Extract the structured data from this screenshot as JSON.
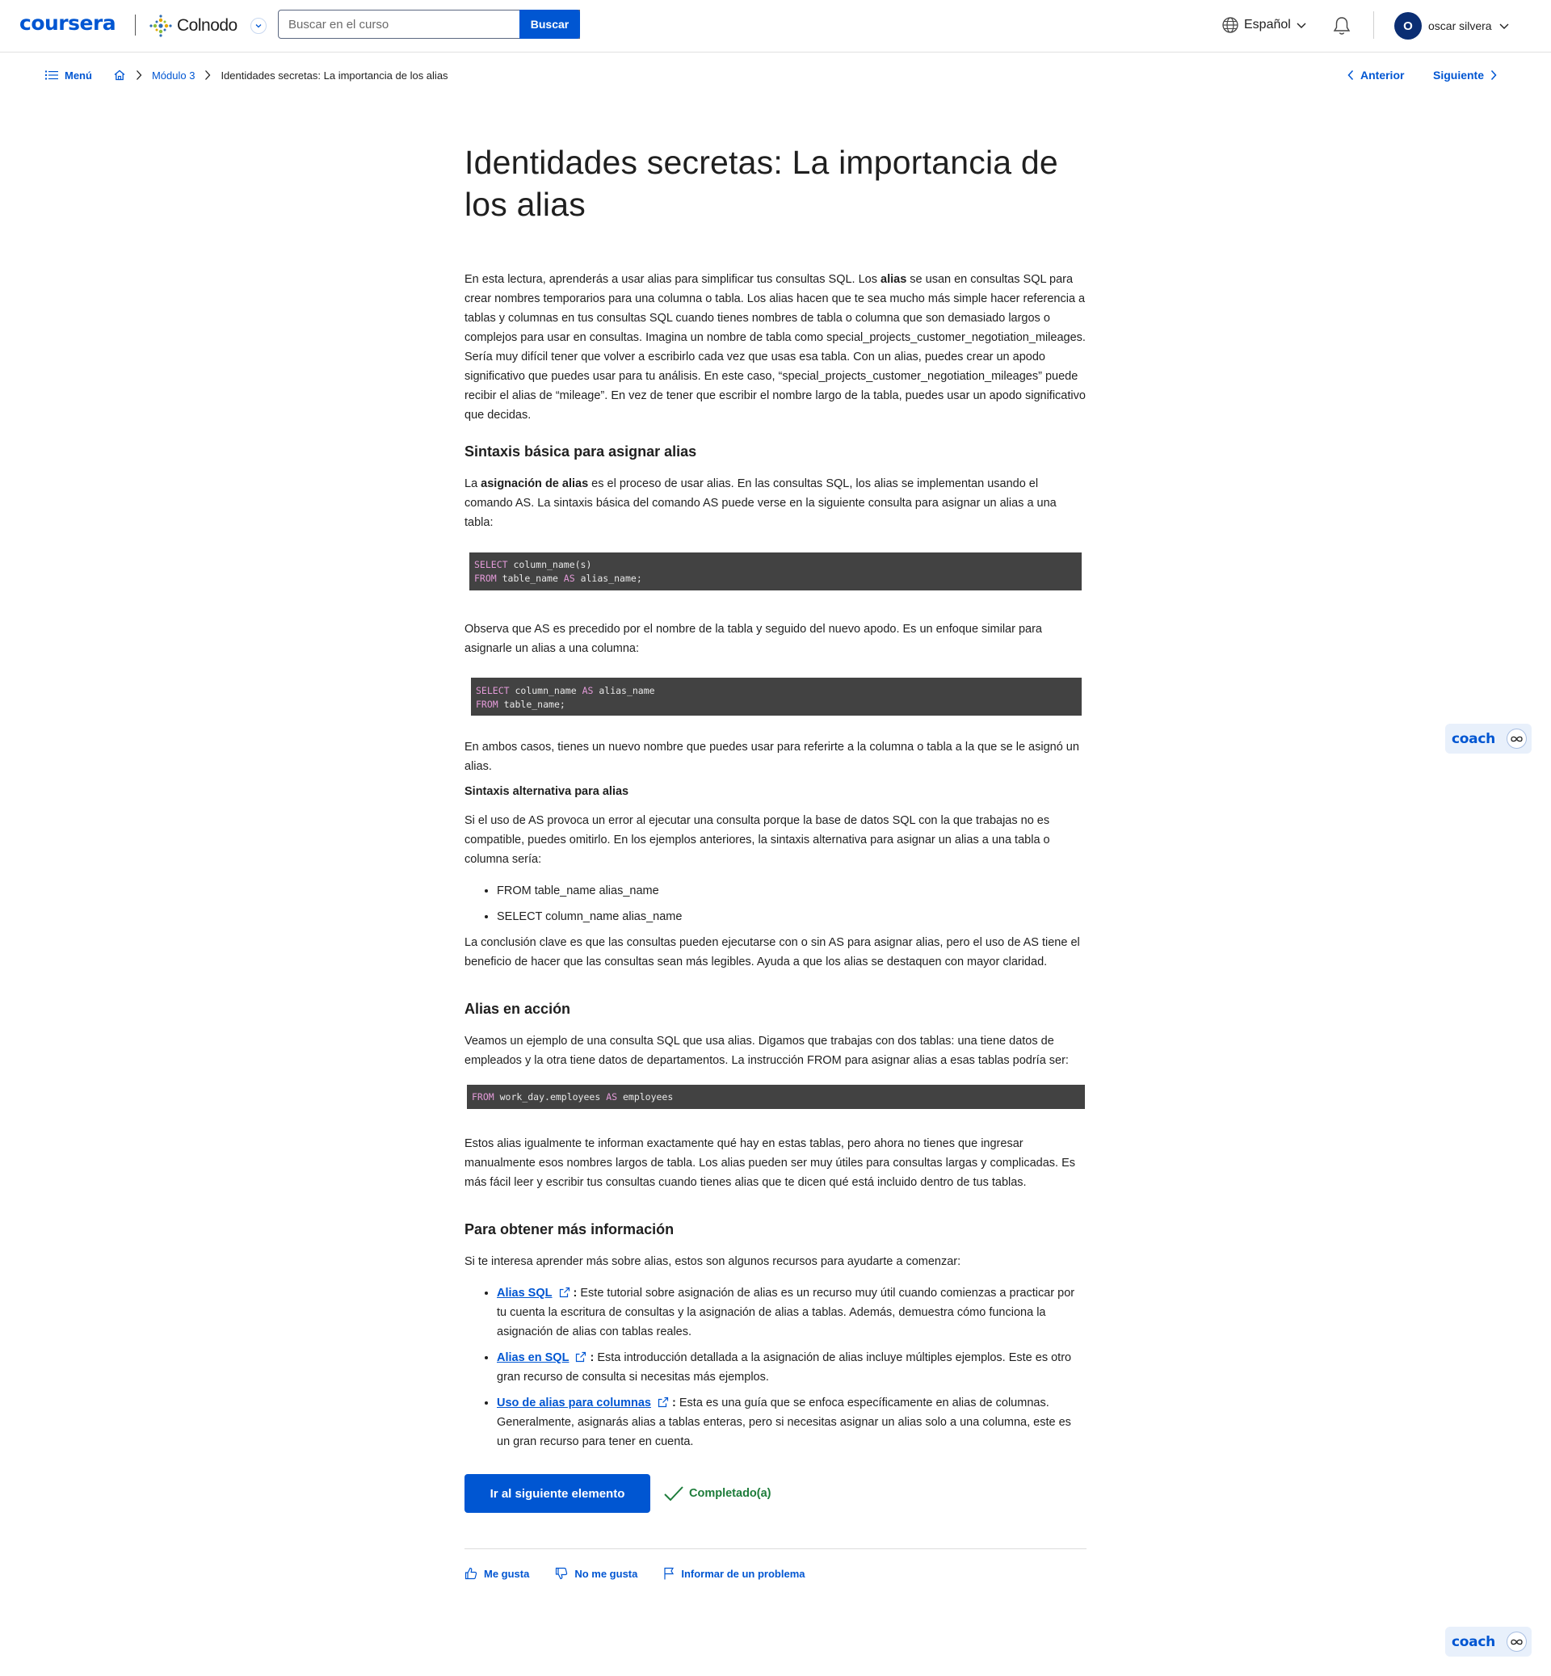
{
  "header": {
    "logo": "coursera",
    "partner": "Colnodo",
    "search_placeholder": "Buscar en el curso",
    "search_button": "Buscar",
    "language": "Español",
    "user_initial": "O",
    "user_name": "oscar silvera"
  },
  "breadcrumb": {
    "menu": "Menú",
    "module": "Módulo 3",
    "current": "Identidades secretas: La importancia de los alias"
  },
  "pager": {
    "prev": "Anterior",
    "next": "Siguiente"
  },
  "article": {
    "title": "Identidades secretas: La importancia de los alias",
    "intro": [
      "En esta lectura, aprenderás a usar alias para simplificar tus consultas SQL. Los ",
      "alias",
      " se usan en consultas SQL para crear nombres temporarios para una columna o tabla. Los alias hacen que te sea mucho más simple hacer referencia a tablas y columnas en tus consultas SQL cuando tienes nombres de tabla o columna que son demasiado largos o complejos para usar en consultas. Imagina un nombre de tabla como special_projects_customer_negotiation_mileages. Sería muy difícil tener que volver a escribirlo cada vez que usas esa tabla. Con un alias, puedes crear un apodo significativo que puedes usar para tu análisis. En este caso, “special_projects_customer_negotiation_mileages” puede recibir el alias de “mileage”. En vez de tener que escribir el nombre largo de la tabla, puedes usar un apodo significativo que decidas."
    ],
    "h_basic": "Sintaxis básica para asignar alias",
    "basic_p": [
      "La ",
      "asignación de alias",
      " es el proceso de usar alias. En las consultas SQL, los alias se implementan usando el comando AS. La sintaxis básica del comando AS puede verse en la siguiente consulta para asignar un alias a una tabla:"
    ],
    "code1": [
      {
        "kw": "SELECT",
        "rest": " column_name(s)"
      },
      {
        "kw": "FROM",
        "rest": " table_name AS alias_name;"
      }
    ],
    "code1_as": "AS",
    "observe_p": "Observa que AS es precedido por el nombre de la tabla y seguido del nuevo apodo. Es un enfoque similar para asignarle un alias a una columna:",
    "code2": [
      {
        "kw": "SELECT",
        "rest": " column_name AS alias_name"
      },
      {
        "kw": "FROM",
        "rest": " table_name;"
      }
    ],
    "both_p": "En ambos casos, tienes un nuevo nombre que puedes usar para referirte a la columna o tabla a la que se le asignó un alias.",
    "h_alt": "Sintaxis alternativa para alias",
    "alt_p": "Si el uso de AS provoca un error al ejecutar una consulta porque la base de datos SQL con la que trabajas no es compatible, puedes omitirlo. En los ejemplos anteriores, la sintaxis alternativa para asignar un alias a una tabla o columna sería:",
    "alt_list": [
      "FROM table_name alias_name",
      "SELECT column_name alias_name"
    ],
    "conclusion_p": "La conclusión clave es que las consultas pueden ejecutarse con o sin AS para asignar alias, pero el uso de AS tiene el beneficio de hacer que las consultas sean más legibles. Ayuda a que los alias se destaquen con mayor claridad.",
    "h_action": "Alias en acción",
    "action_p": "Veamos un ejemplo de una consulta SQL que usa alias. Digamos que trabajas con dos tablas: una tiene datos de empleados y la otra tiene datos de departamentos. La instrucción FROM para asignar alias a esas tablas podría ser:",
    "code3": {
      "kw1": "FROM",
      "mid": " work_day.employees ",
      "kw2": "AS",
      "end": " employees"
    },
    "after_p": "Estos alias igualmente te informan exactamente qué hay en estas tablas, pero ahora no tienes que ingresar manualmente esos nombres largos de tabla. Los alias pueden ser muy útiles para consultas largas y complicadas. Es más fácil leer y escribir tus consultas cuando tienes alias que te dicen qué está incluido dentro de tus tablas.",
    "h_more": "Para obtener más información",
    "more_p": "Si te interesa aprender más sobre alias, estos son algunos recursos para ayudarte a comenzar:",
    "resources": [
      {
        "link": "Alias SQL",
        "text": "Este tutorial sobre asignación de alias es un recurso muy útil cuando comienzas a practicar por tu cuenta la escritura de consultas y la asignación de alias a tablas. Además, demuestra cómo funciona la asignación de alias con tablas reales."
      },
      {
        "link": "Alias en SQL",
        "text": "Esta introducción detallada a la asignación de alias incluye múltiples ejemplos. Este es otro gran recurso de consulta si necesitas más ejemplos."
      },
      {
        "link": "Uso de alias para columnas",
        "text": "Esta es una guía que se enfoca específicamente en alias de columnas. Generalmente, asignarás alias a tablas enteras, pero si necesitas asignar un alias solo a una columna, este es un gran recurso para tener en cuenta."
      }
    ]
  },
  "actions": {
    "next_button": "Ir al siguiente elemento",
    "completed": "Completado(a)"
  },
  "feedback": {
    "like": "Me gusta",
    "dislike": "No me gusta",
    "report": "Informar de un problema"
  },
  "coach": {
    "label": "coach"
  },
  "colors": {
    "brand": "#0056d2",
    "code_bg": "#424242",
    "keyword": "#e39ad8",
    "success": "#1d7c3a"
  }
}
